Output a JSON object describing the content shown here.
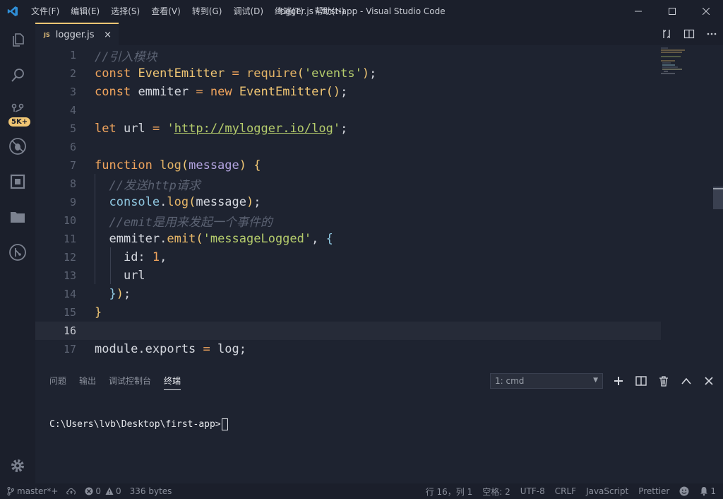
{
  "window": {
    "title": "logger.js - first-app - Visual Studio Code",
    "menu": [
      "文件(F)",
      "编辑(E)",
      "选择(S)",
      "查看(V)",
      "转到(G)",
      "调试(D)",
      "终端(T)",
      "帮助(H)"
    ]
  },
  "activity": {
    "scm_badge": "5K+"
  },
  "tab": {
    "icon_label": "JS",
    "filename": "logger.js",
    "close": "×"
  },
  "editor": {
    "lines": [
      "1",
      "2",
      "3",
      "4",
      "5",
      "6",
      "7",
      "8",
      "9",
      "10",
      "11",
      "12",
      "13",
      "14",
      "15",
      "16",
      "17"
    ],
    "current_line": "16"
  },
  "panel": {
    "tabs": [
      "问题",
      "输出",
      "调试控制台",
      "终端"
    ],
    "active_tab": "终端",
    "terminal_select": "1: cmd",
    "prompt": "C:\\Users\\lvb\\Desktop\\first-app>"
  },
  "status": {
    "branch": "master*+",
    "errors": "0",
    "warnings": "0",
    "size": "336 bytes",
    "position": "行 16，列 1",
    "spaces": "空格: 2",
    "encoding": "UTF-8",
    "eol": "CRLF",
    "language": "JavaScript",
    "formatter": "Prettier"
  },
  "colors": {
    "accent": "#f0c674",
    "background": "#1e2330",
    "chrome": "#1b1f2b"
  }
}
